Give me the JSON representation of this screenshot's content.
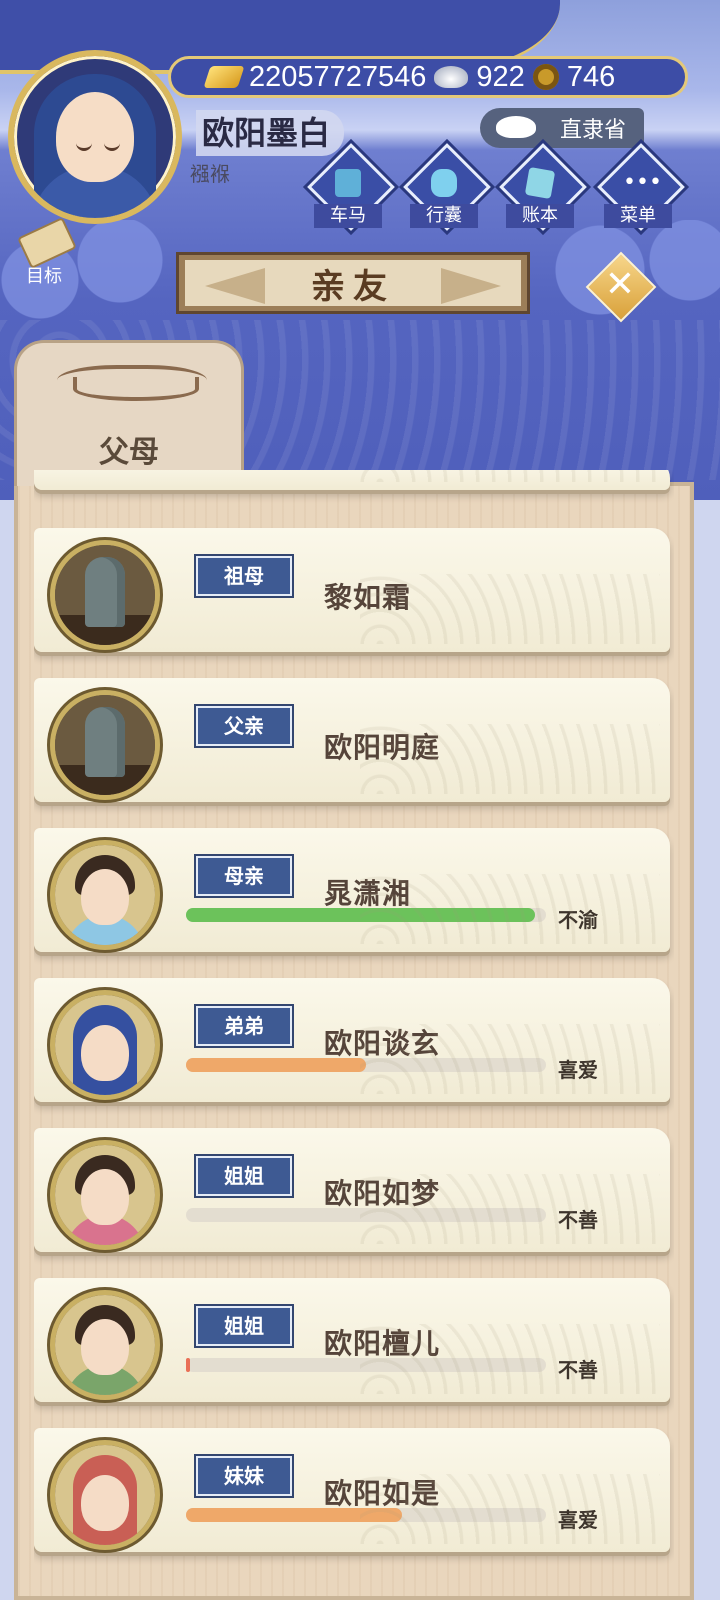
{
  "header": {
    "gold": "22057727546",
    "silver": "922",
    "coins": "746",
    "player_name": "欧阳墨白",
    "player_sub": "襁褓",
    "province": "直隶省",
    "goal_label": "目标",
    "menu": [
      {
        "label": "车马",
        "icon": "carriage-icon"
      },
      {
        "label": "行囊",
        "icon": "bag-icon"
      },
      {
        "label": "账本",
        "icon": "ledger-icon"
      },
      {
        "label": "菜单",
        "icon": "more-icon"
      }
    ]
  },
  "title": "亲友",
  "tab_label": "父母",
  "relatives": [
    {
      "relation": "祖母",
      "name": "黎如霜",
      "portrait": "tombstone",
      "mood": "",
      "favor": null
    },
    {
      "relation": "父亲",
      "name": "欧阳明庭",
      "portrait": "tombstone",
      "mood": "",
      "favor": null
    },
    {
      "relation": "母亲",
      "name": "晁潇湘",
      "portrait": "woman",
      "mood": "不渝",
      "favor": 0.97,
      "bar_color": "#6cc25b"
    },
    {
      "relation": "弟弟",
      "name": "欧阳谈玄",
      "portrait": "baby-blue",
      "mood": "喜爱",
      "favor": 0.5,
      "bar_color": "#efa869"
    },
    {
      "relation": "姐姐",
      "name": "欧阳如梦",
      "portrait": "girl",
      "mood": "不善",
      "favor": 0.0,
      "bar_color": "#e96f56"
    },
    {
      "relation": "姐姐",
      "name": "欧阳檀儿",
      "portrait": "girl2",
      "mood": "不善",
      "favor": 0.01,
      "bar_color": "#e96f56"
    },
    {
      "relation": "妹妹",
      "name": "欧阳如是",
      "portrait": "baby-pink",
      "mood": "喜爱",
      "favor": 0.6,
      "bar_color": "#efa869"
    }
  ],
  "colors": {
    "banner_text": "#5a3c22",
    "badge_bg": "#3e5a93",
    "panel_bg": "#e9d6bd"
  }
}
